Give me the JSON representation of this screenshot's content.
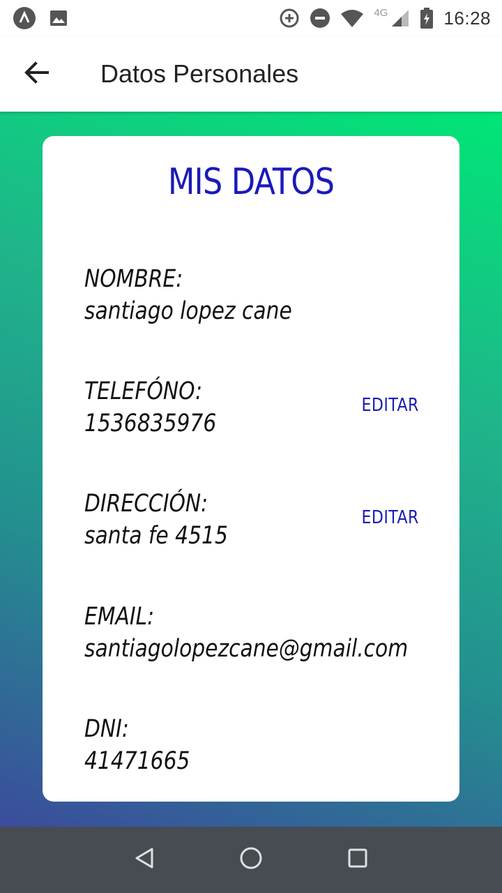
{
  "status_bar": {
    "time": "16:28",
    "network": "4G",
    "icons": [
      "app-icon",
      "image-icon",
      "data-saver-icon",
      "do-not-disturb-icon",
      "wifi-icon",
      "signal-icon",
      "battery-icon"
    ]
  },
  "app_bar": {
    "title": "Datos Personales",
    "back_icon": "arrow-left-icon"
  },
  "card": {
    "title": "MIS DATOS",
    "fields": [
      {
        "label": "NOMBRE:",
        "value": "santiago lopez cane",
        "editable": false
      },
      {
        "label": "TELEFÓNO:",
        "value": "1536835976",
        "editable": true,
        "edit_label": "EDITAR"
      },
      {
        "label": "DIRECCIÓN:",
        "value": "santa fe 4515",
        "editable": true,
        "edit_label": "EDITAR"
      },
      {
        "label": "EMAIL:",
        "value": "santiagolopezcane@gmail.com",
        "editable": false
      },
      {
        "label": "DNI:",
        "value": "41471665",
        "editable": false
      }
    ]
  },
  "nav_bar": {
    "icons": [
      "back-triangle-icon",
      "home-circle-icon",
      "recents-square-icon"
    ]
  },
  "colors": {
    "accent": "#1a1ab8",
    "gradient_top": "#00e676",
    "gradient_bottom": "#3b4c9c",
    "nav_bar": "#474c53"
  }
}
